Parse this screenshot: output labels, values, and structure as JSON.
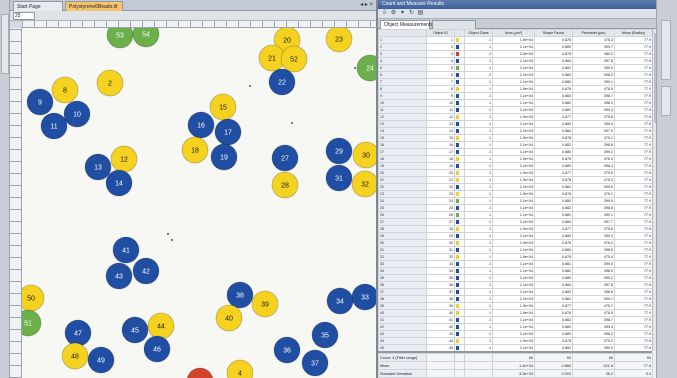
{
  "doc_tabs": {
    "start": "Start Page",
    "image": "Polystyrene6Beads.tif"
  },
  "nav": {
    "arrows": "◂ ▸ ×"
  },
  "zoom": {
    "value": "25"
  },
  "results_panel": {
    "title": "Count and Measure Results",
    "tab_object": "Object Measurements",
    "tab_other": ""
  },
  "table": {
    "headers": [
      "",
      "Object ID",
      "",
      "Object Class",
      "Area (µm²)",
      "Shape Factor",
      "Perimeter (µm)",
      "Mean (Radius)"
    ],
    "rows": [
      [
        "1",
        "1",
        "y",
        "1",
        "1.9e+04",
        "0.876",
        "476.3",
        "77.9"
      ],
      [
        "2",
        "2",
        "b",
        "1",
        "1.1e+04",
        "0.880",
        "399.7",
        "77.9"
      ],
      [
        "3",
        "3",
        "r",
        "2",
        "2.0e+04",
        "0.878",
        "480.2",
        "77.9"
      ],
      [
        "4",
        "4",
        "b",
        "1",
        "1.1e+04",
        "0.884",
        "397.8",
        "77.9"
      ],
      [
        "5",
        "5",
        "g",
        "1",
        "1.1e+04",
        "0.881",
        "399.0",
        "77.9"
      ],
      [
        "6",
        "6",
        "b",
        "2",
        "1.1e+04",
        "0.883",
        "398.2",
        "77.9"
      ],
      [
        "7",
        "7",
        "b",
        "1",
        "1.1e+04",
        "0.880",
        "399.1",
        "77.9"
      ],
      [
        "8",
        "8",
        "y",
        "1",
        "1.9e+04",
        "0.876",
        "476.0",
        "77.9"
      ],
      [
        "9",
        "9",
        "b",
        "1",
        "1.1e+04",
        "0.883",
        "398.7",
        "77.9"
      ],
      [
        "10",
        "10",
        "b",
        "1",
        "1.1e+04",
        "0.882",
        "398.9",
        "77.9"
      ],
      [
        "11",
        "11",
        "b",
        "1",
        "1.1e+04",
        "0.881",
        "399.3",
        "77.9"
      ],
      [
        "12",
        "12",
        "y",
        "1",
        "1.9e+04",
        "0.877",
        "475.8",
        "77.9"
      ],
      [
        "13",
        "13",
        "b",
        "1",
        "1.1e+04",
        "0.880",
        "399.4",
        "77.9"
      ],
      [
        "14",
        "14",
        "b",
        "1",
        "1.1e+04",
        "0.884",
        "397.9",
        "77.9"
      ],
      [
        "15",
        "15",
        "y",
        "1",
        "1.9e+04",
        "0.878",
        "475.1",
        "77.9"
      ],
      [
        "16",
        "16",
        "b",
        "1",
        "1.1e+04",
        "0.882",
        "398.6",
        "77.9"
      ],
      [
        "17",
        "17",
        "b",
        "1",
        "1.1e+04",
        "0.880",
        "399.2",
        "77.9"
      ],
      [
        "18",
        "18",
        "y",
        "1",
        "1.9e+04",
        "0.876",
        "476.4",
        "77.9"
      ],
      [
        "19",
        "19",
        "b",
        "1",
        "1.1e+04",
        "0.883",
        "398.4",
        "77.9"
      ],
      [
        "20",
        "20",
        "y",
        "1",
        "1.9e+04",
        "0.877",
        "475.9",
        "77.9"
      ],
      [
        "21",
        "21",
        "y",
        "1",
        "1.9e+04",
        "0.878",
        "475.3",
        "77.9"
      ],
      [
        "22",
        "22",
        "b",
        "1",
        "1.1e+04",
        "0.881",
        "399.0",
        "77.9"
      ],
      [
        "23",
        "23",
        "y",
        "1",
        "1.9e+04",
        "0.876",
        "476.1",
        "77.9"
      ],
      [
        "24",
        "24",
        "g",
        "1",
        "1.1e+04",
        "0.880",
        "399.5",
        "77.9"
      ],
      [
        "25",
        "25",
        "b",
        "1",
        "1.1e+04",
        "0.882",
        "398.8",
        "77.9"
      ],
      [
        "26",
        "26",
        "g",
        "1",
        "1.1e+04",
        "0.881",
        "399.1",
        "77.9"
      ],
      [
        "27",
        "27",
        "b",
        "1",
        "1.1e+04",
        "0.884",
        "397.7",
        "77.9"
      ],
      [
        "28",
        "28",
        "y",
        "1",
        "1.9e+04",
        "0.877",
        "475.6",
        "77.9"
      ],
      [
        "29",
        "29",
        "b",
        "1",
        "1.1e+04",
        "0.880",
        "399.3",
        "77.9"
      ],
      [
        "30",
        "30",
        "y",
        "1",
        "1.9e+04",
        "0.876",
        "476.2",
        "77.9"
      ],
      [
        "31",
        "31",
        "b",
        "1",
        "1.1e+04",
        "0.883",
        "398.5",
        "77.9"
      ],
      [
        "32",
        "32",
        "y",
        "1",
        "1.9e+04",
        "0.878",
        "475.4",
        "77.9"
      ],
      [
        "33",
        "33",
        "b",
        "1",
        "1.1e+04",
        "0.881",
        "399.0",
        "77.9"
      ],
      [
        "34",
        "34",
        "b",
        "1",
        "1.1e+04",
        "0.882",
        "398.9",
        "77.9"
      ],
      [
        "35",
        "35",
        "b",
        "1",
        "1.1e+04",
        "0.880",
        "399.2",
        "77.9"
      ],
      [
        "36",
        "36",
        "b",
        "1",
        "1.1e+04",
        "0.884",
        "397.8",
        "77.9"
      ],
      [
        "37",
        "37",
        "b",
        "1",
        "1.1e+04",
        "0.883",
        "398.6",
        "77.9"
      ],
      [
        "38",
        "38",
        "b",
        "1",
        "1.1e+04",
        "0.881",
        "399.1",
        "77.9"
      ],
      [
        "39",
        "39",
        "y",
        "1",
        "1.9e+04",
        "0.877",
        "475.7",
        "77.9"
      ],
      [
        "40",
        "40",
        "y",
        "1",
        "1.9e+04",
        "0.876",
        "476.0",
        "77.9"
      ],
      [
        "41",
        "41",
        "b",
        "1",
        "1.1e+04",
        "0.882",
        "398.7",
        "77.9"
      ],
      [
        "42",
        "42",
        "b",
        "1",
        "1.1e+04",
        "0.880",
        "399.4",
        "77.9"
      ],
      [
        "43",
        "43",
        "b",
        "1",
        "1.1e+04",
        "0.883",
        "398.3",
        "77.9"
      ],
      [
        "44",
        "44",
        "y",
        "1",
        "1.9e+04",
        "0.878",
        "475.2",
        "77.9"
      ],
      [
        "45",
        "45",
        "b",
        "1",
        "1.1e+04",
        "0.881",
        "399.0",
        "77.9"
      ],
      [
        "46",
        "46",
        "b",
        "1",
        "1.1e+04",
        "0.884",
        "397.9",
        "77.9"
      ],
      [
        "47",
        "47",
        "b",
        "1",
        "1.1e+04",
        "0.882",
        "398.8",
        "77.9"
      ],
      [
        "48",
        "48",
        "y",
        "1",
        "1.9e+04",
        "0.877",
        "475.9",
        "77.9"
      ]
    ]
  },
  "summary": {
    "rows": [
      [
        "Count: 4 (Filter range)",
        "",
        "",
        "",
        "50",
        "50",
        "50",
        "50"
      ],
      [
        "Mean",
        "",
        "",
        "",
        "1.4e+04",
        "0.880",
        "421.6",
        "77.9"
      ],
      [
        "Standard Deviation",
        "",
        "",
        "",
        "3.9e+03",
        "0.003",
        "35.2",
        "0.0"
      ]
    ]
  },
  "colors": {
    "blue": "#1f4ea3",
    "yellow": "#f4d21f",
    "green": "#6bb04a",
    "red": "#d0452a",
    "label_light": "#ffffff",
    "label_dark": "#1b1b1b"
  },
  "beads": [
    {
      "id": "53",
      "color": "green"
    },
    {
      "id": "54",
      "color": "green"
    },
    {
      "id": "20",
      "color": "yellow"
    },
    {
      "id": "23",
      "color": "yellow"
    },
    {
      "id": "21",
      "color": "yellow"
    },
    {
      "id": "52",
      "color": "yellow"
    },
    {
      "id": "22",
      "color": "blue"
    },
    {
      "id": "24",
      "color": "green"
    },
    {
      "id": "2",
      "color": "yellow"
    },
    {
      "id": "8",
      "color": "yellow"
    },
    {
      "id": "9",
      "color": "blue"
    },
    {
      "id": "10",
      "color": "blue"
    },
    {
      "id": "11",
      "color": "blue"
    },
    {
      "id": "15",
      "color": "yellow"
    },
    {
      "id": "16",
      "color": "blue"
    },
    {
      "id": "17",
      "color": "blue"
    },
    {
      "id": "18",
      "color": "yellow"
    },
    {
      "id": "19",
      "color": "blue"
    },
    {
      "id": "27",
      "color": "blue"
    },
    {
      "id": "28",
      "color": "yellow"
    },
    {
      "id": "29",
      "color": "blue"
    },
    {
      "id": "30",
      "color": "yellow"
    },
    {
      "id": "31",
      "color": "blue"
    },
    {
      "id": "32",
      "color": "yellow"
    },
    {
      "id": "12",
      "color": "yellow"
    },
    {
      "id": "13",
      "color": "blue"
    },
    {
      "id": "14",
      "color": "blue"
    },
    {
      "id": "41",
      "color": "blue"
    },
    {
      "id": "42",
      "color": "blue"
    },
    {
      "id": "43",
      "color": "blue"
    },
    {
      "id": "38",
      "color": "blue"
    },
    {
      "id": "39",
      "color": "yellow"
    },
    {
      "id": "40",
      "color": "yellow"
    },
    {
      "id": "34",
      "color": "blue"
    },
    {
      "id": "33",
      "color": "blue"
    },
    {
      "id": "35",
      "color": "blue"
    },
    {
      "id": "36",
      "color": "blue"
    },
    {
      "id": "37",
      "color": "blue"
    },
    {
      "id": "45",
      "color": "blue"
    },
    {
      "id": "44",
      "color": "yellow"
    },
    {
      "id": "46",
      "color": "blue"
    },
    {
      "id": "47",
      "color": "blue"
    },
    {
      "id": "48",
      "color": "yellow"
    },
    {
      "id": "49",
      "color": "blue"
    },
    {
      "id": "50",
      "color": "yellow"
    },
    {
      "id": "51",
      "color": "green"
    },
    {
      "id": "4",
      "color": "yellow"
    },
    {
      "id": "",
      "color": "red"
    }
  ]
}
